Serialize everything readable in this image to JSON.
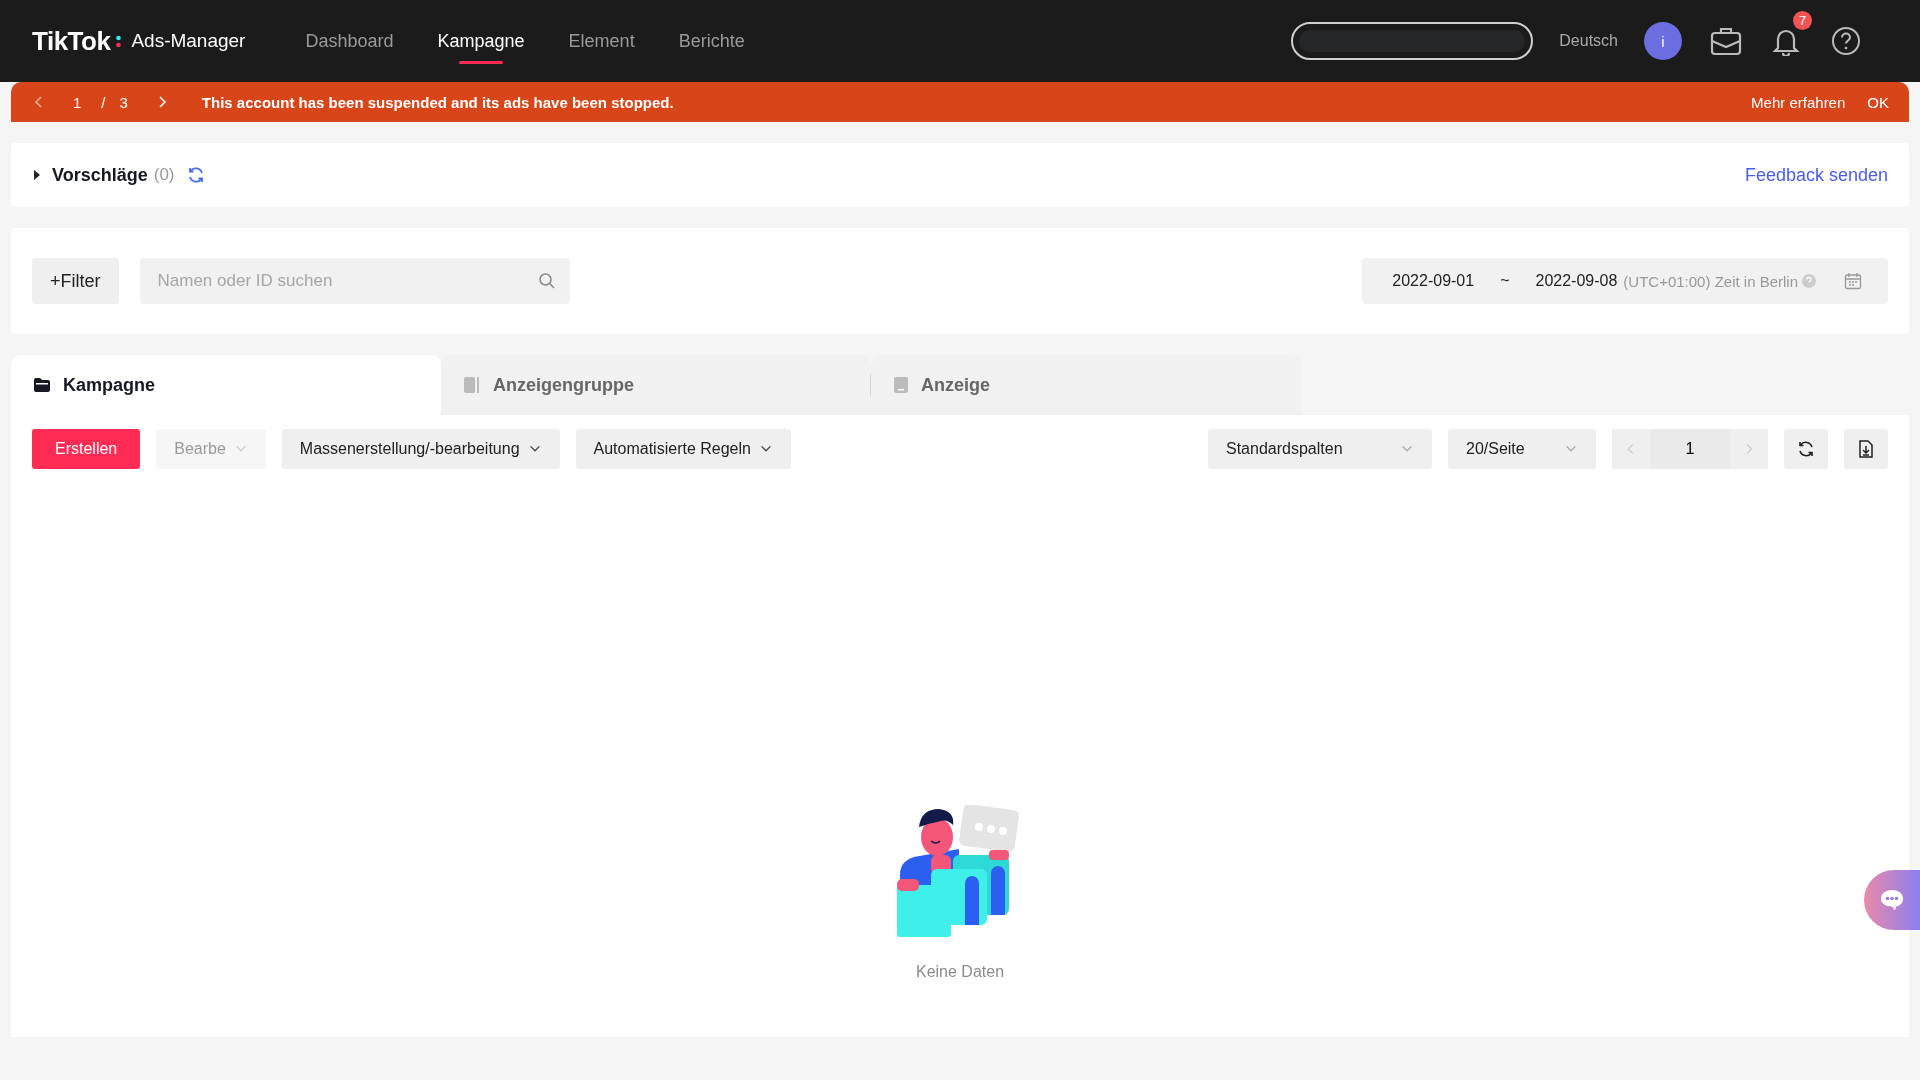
{
  "header": {
    "logo": "TikTok",
    "product": "Ads-Manager",
    "nav": [
      {
        "label": "Dashboard",
        "selected": false
      },
      {
        "label": "Kampagne",
        "selected": true
      },
      {
        "label": "Element",
        "selected": false
      },
      {
        "label": "Berichte",
        "selected": false
      }
    ],
    "language": "Deutsch",
    "avatar": "i",
    "notification_count": "7"
  },
  "banner": {
    "page": "1",
    "separator": "/",
    "total": "3",
    "message": "This account has been suspended and its ads have been stopped.",
    "link": "Mehr erfahren",
    "ok": "OK"
  },
  "suggestions": {
    "title": "Vorschläge",
    "count": "(0)",
    "expanded": false,
    "feedback": "Feedback senden"
  },
  "filter": {
    "button": "+Filter",
    "search_placeholder": "Namen oder ID suchen",
    "date_start": "2022-09-01",
    "date_sep": "~",
    "date_end": "2022-09-08",
    "timezone": "(UTC+01:00) Zeit in Berlin"
  },
  "tabs": [
    {
      "label": "Kampagne",
      "selected": true,
      "kind": "folder"
    },
    {
      "label": "Anzeigengruppe",
      "selected": false,
      "kind": "group"
    },
    {
      "label": "Anzeige",
      "selected": false,
      "kind": "ad"
    }
  ],
  "toolbar": {
    "create": "Erstellen",
    "actions": [
      {
        "label": "Bearbe",
        "disabled": true
      },
      {
        "label": "Massenerstellung/-bearbeitung",
        "disabled": false
      },
      {
        "label": "Automatisierte Regeln",
        "disabled": false
      }
    ],
    "columns": "Standardspalten",
    "page_size": "20/Seite",
    "page": "1"
  },
  "empty": {
    "text": "Keine Daten"
  }
}
